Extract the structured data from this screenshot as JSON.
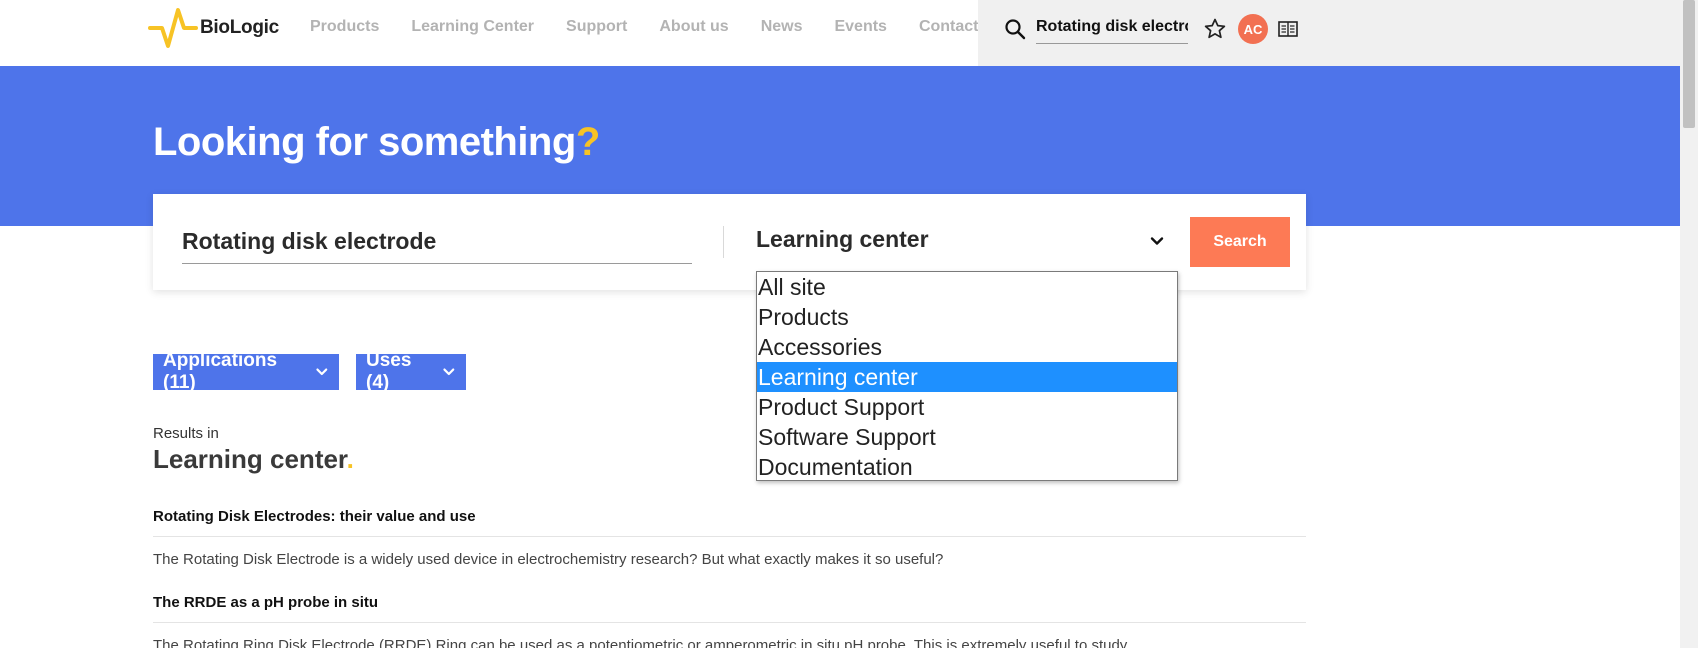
{
  "header": {
    "logo_text": "BioLogic",
    "nav": [
      "Products",
      "Learning Center",
      "Support",
      "About us",
      "News",
      "Events",
      "Contact"
    ],
    "search_value": "Rotating disk electro",
    "avatar_initials": "AC"
  },
  "hero": {
    "title": "Looking for something",
    "title_mark": "?"
  },
  "search_panel": {
    "query": "Rotating disk electrode",
    "scope_selected": "Learning center",
    "button_label": "Search",
    "scope_options": [
      "All site",
      "Products",
      "Accessories",
      "Learning center",
      "Product Support",
      "Software Support",
      "Documentation"
    ],
    "highlighted_option": "Learning center"
  },
  "filters": {
    "applications": "Applications (11)",
    "uses": "Uses (4)"
  },
  "results": {
    "results_in_label": "Results in",
    "heading": "Learning center",
    "heading_mark": ".",
    "items": [
      {
        "title": "Rotating Disk Electrodes: their value and use",
        "description": "The Rotating Disk Electrode is a widely used device in electrochemistry research? But what exactly makes it so useful?"
      },
      {
        "title": "The RRDE as a pH probe in situ",
        "description": "The Rotating Ring Disk Electrode (RRDE) Ring can be used as a potentiometric or amperometric in situ pH probe. This is extremely useful to study"
      }
    ]
  },
  "colors": {
    "brand_blue": "#4e74ea",
    "accent_yellow": "#f7c325",
    "button_orange": "#fd7a55",
    "avatar_orange": "#f27052",
    "option_highlight": "#1e90ff"
  }
}
